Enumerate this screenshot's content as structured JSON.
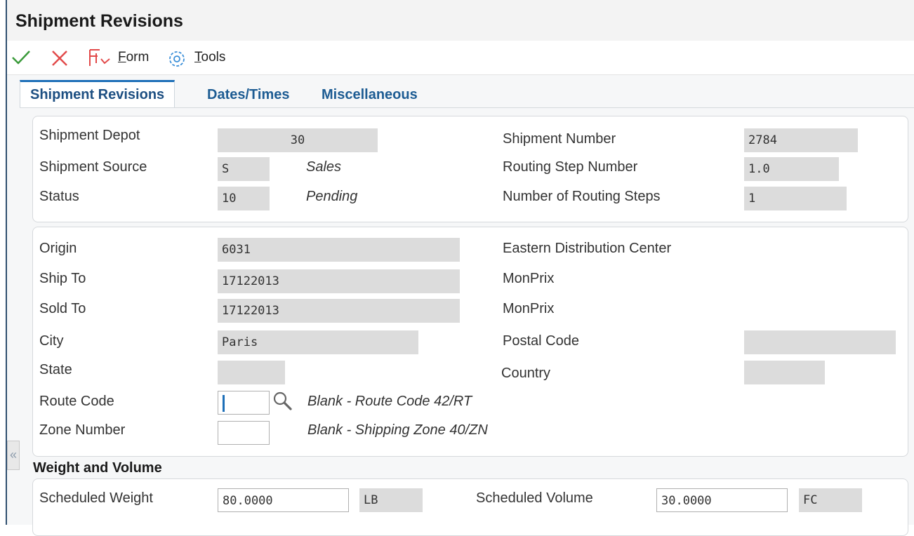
{
  "window": {
    "title": "Shipment Revisions"
  },
  "toolbar": {
    "form_label_u": "F",
    "form_label_rest": "orm",
    "tools_label_u": "T",
    "tools_label_rest": "ools"
  },
  "tabs": [
    {
      "label": "Shipment Revisions"
    },
    {
      "label": "Dates/Times"
    },
    {
      "label": "Miscellaneous"
    }
  ],
  "header": {
    "shipment_depot": {
      "label": "Shipment Depot",
      "value": "30"
    },
    "shipment_source": {
      "label": "Shipment Source",
      "value": "S",
      "desc": "Sales"
    },
    "status": {
      "label": "Status",
      "value": "10",
      "desc": "Pending"
    },
    "shipment_number": {
      "label": "Shipment Number",
      "value": "2784"
    },
    "routing_step_number": {
      "label": "Routing Step Number",
      "value": "1.0"
    },
    "number_of_routing_steps": {
      "label": "Number of Routing Steps",
      "value": "1"
    }
  },
  "address": {
    "origin": {
      "label": "Origin",
      "value": "6031",
      "desc": "Eastern Distribution Center"
    },
    "ship_to": {
      "label": "Ship To",
      "value": "17122013",
      "desc": "MonPrix"
    },
    "sold_to": {
      "label": "Sold To",
      "value": "17122013",
      "desc": "MonPrix"
    },
    "city": {
      "label": "City",
      "value": "Paris"
    },
    "postal_code": {
      "label": "Postal Code",
      "value": ""
    },
    "state": {
      "label": "State",
      "value": ""
    },
    "country": {
      "label": "Country",
      "value": ""
    },
    "route_code": {
      "label": "Route Code",
      "value": "",
      "desc": "Blank - Route Code 42/RT"
    },
    "zone_number": {
      "label": "Zone Number",
      "value": "",
      "desc": "Blank - Shipping Zone 40/ZN"
    }
  },
  "weight_volume": {
    "section_title": "Weight and Volume",
    "scheduled_weight": {
      "label": "Scheduled Weight",
      "value": "80.0000",
      "uom": "LB"
    },
    "scheduled_volume": {
      "label": "Scheduled Volume",
      "value": "30.0000",
      "uom": "FC"
    }
  },
  "colors": {
    "accent": "#1d6fb8",
    "ok": "#3a9a3a",
    "cancel": "#e24a4a",
    "field_bg": "#dcdcdc"
  },
  "icons": [
    "check-icon",
    "cancel-icon",
    "form-menu-icon",
    "tools-gear-icon",
    "search-icon",
    "collapse-icon"
  ]
}
